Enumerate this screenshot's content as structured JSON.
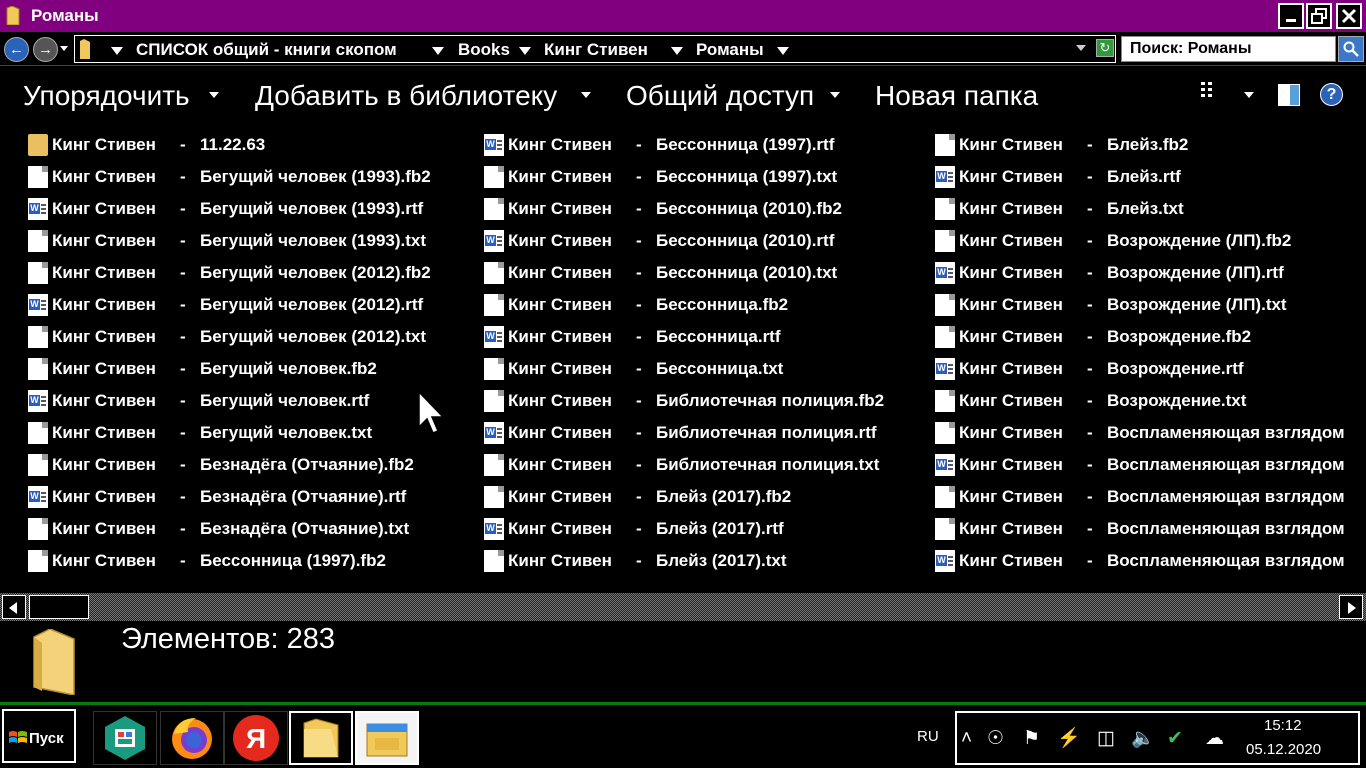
{
  "window": {
    "title": "Романы"
  },
  "address": {
    "crumbs": [
      "СПИСОК общий - книги скопом",
      "Books",
      "Кинг Стивен",
      "Романы"
    ],
    "search_text": "Поиск: Романы"
  },
  "toolbar": {
    "organize": "Упорядочить",
    "add_library": "Добавить в библиотеку",
    "share": "Общий доступ",
    "new_folder": "Новая папка"
  },
  "file_prefix": "Кинг Стивен",
  "file_sep": "-",
  "files": {
    "col1": [
      {
        "name": "11.22.63",
        "type": "folder"
      },
      {
        "name": "Бегущий человек (1993).fb2",
        "type": "doc"
      },
      {
        "name": "Бегущий человек (1993).rtf",
        "type": "rtf"
      },
      {
        "name": "Бегущий человек (1993).txt",
        "type": "doc"
      },
      {
        "name": "Бегущий человек (2012).fb2",
        "type": "doc"
      },
      {
        "name": "Бегущий человек (2012).rtf",
        "type": "rtf"
      },
      {
        "name": "Бегущий человек (2012).txt",
        "type": "doc"
      },
      {
        "name": "Бегущий человек.fb2",
        "type": "doc"
      },
      {
        "name": "Бегущий человек.rtf",
        "type": "rtf"
      },
      {
        "name": "Бегущий человек.txt",
        "type": "doc"
      },
      {
        "name": "Безнадёга (Отчаяние).fb2",
        "type": "doc"
      },
      {
        "name": "Безнадёга (Отчаяние).rtf",
        "type": "rtf"
      },
      {
        "name": "Безнадёга (Отчаяние).txt",
        "type": "doc"
      },
      {
        "name": "Бессонница (1997).fb2",
        "type": "doc"
      }
    ],
    "col2": [
      {
        "name": "Бессонница (1997).rtf",
        "type": "rtf"
      },
      {
        "name": "Бессонница (1997).txt",
        "type": "doc"
      },
      {
        "name": "Бессонница (2010).fb2",
        "type": "doc"
      },
      {
        "name": "Бессонница (2010).rtf",
        "type": "rtf"
      },
      {
        "name": "Бессонница (2010).txt",
        "type": "doc"
      },
      {
        "name": "Бессонница.fb2",
        "type": "doc"
      },
      {
        "name": "Бессонница.rtf",
        "type": "rtf"
      },
      {
        "name": "Бессонница.txt",
        "type": "doc"
      },
      {
        "name": "Библиотечная полиция.fb2",
        "type": "doc"
      },
      {
        "name": "Библиотечная полиция.rtf",
        "type": "rtf"
      },
      {
        "name": "Библиотечная полиция.txt",
        "type": "doc"
      },
      {
        "name": "Блейз (2017).fb2",
        "type": "doc"
      },
      {
        "name": "Блейз (2017).rtf",
        "type": "rtf"
      },
      {
        "name": "Блейз (2017).txt",
        "type": "doc"
      }
    ],
    "col3": [
      {
        "name": "Блейз.fb2",
        "type": "doc"
      },
      {
        "name": "Блейз.rtf",
        "type": "rtf"
      },
      {
        "name": "Блейз.txt",
        "type": "doc"
      },
      {
        "name": "Возрождение (ЛП).fb2",
        "type": "doc"
      },
      {
        "name": "Возрождение (ЛП).rtf",
        "type": "rtf"
      },
      {
        "name": "Возрождение (ЛП).txt",
        "type": "doc"
      },
      {
        "name": "Возрождение.fb2",
        "type": "doc"
      },
      {
        "name": "Возрождение.rtf",
        "type": "rtf"
      },
      {
        "name": "Возрождение.txt",
        "type": "doc"
      },
      {
        "name": "Воспламеняющая взглядом",
        "type": "doc"
      },
      {
        "name": "Воспламеняющая взглядом",
        "type": "rtf"
      },
      {
        "name": "Воспламеняющая взглядом",
        "type": "doc"
      },
      {
        "name": "Воспламеняющая взглядом",
        "type": "doc"
      },
      {
        "name": "Воспламеняющая взглядом",
        "type": "rtf"
      }
    ]
  },
  "details": {
    "count_text": "Элементов: 283"
  },
  "taskbar": {
    "start_label": "Пуск",
    "lang": "RU",
    "time": "15:12",
    "date": "05.12.2020",
    "apps": [
      "store-app",
      "firefox-app",
      "yandex-app",
      "explorer-app",
      "explorer-window-app"
    ]
  },
  "colors": {
    "titlebar": "#800080",
    "taskbar_border": "#0a7a10",
    "rtf_blue": "#2a5dbe"
  }
}
